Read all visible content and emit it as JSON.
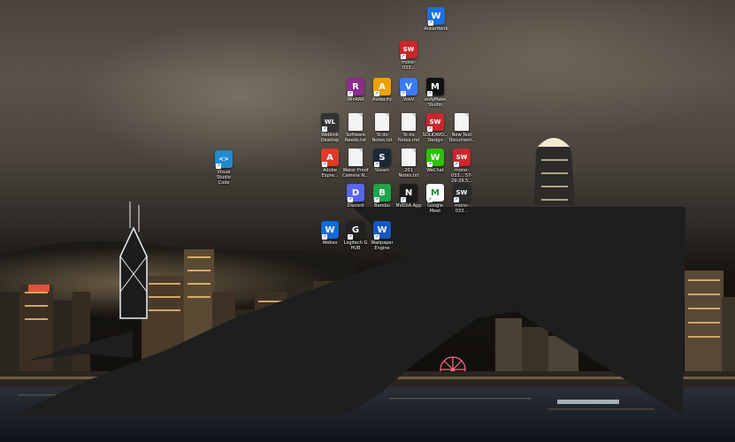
{
  "wallpaper": {
    "sky_color": "#4a443d",
    "water_color": "#1b2430",
    "overlay_color": "#1e1e1e"
  },
  "desktop_icons": [
    {
      "name": "antiwork",
      "label": "AnkerWork",
      "icon": "antiwork-icon",
      "color": "#1e6fe0",
      "glyph": "W"
    },
    {
      "name": "mono-1",
      "label": "mono-033...",
      "icon": "solidworks-icon",
      "color": "#c8282d",
      "glyph": "SW"
    },
    {
      "name": "winrar",
      "label": "WinRAR",
      "icon": "winrar-icon",
      "color": "#8a2d8d",
      "glyph": "R"
    },
    {
      "name": "audacity",
      "label": "Audacity",
      "icon": "audacity-icon",
      "color": "#f0a000",
      "glyph": "A"
    },
    {
      "name": "voov",
      "label": "VooV",
      "icon": "voov-icon",
      "color": "#3a7bff",
      "glyph": "V"
    },
    {
      "name": "eufymake",
      "label": "eufyMake Studio",
      "icon": "eufymake-icon",
      "color": "#111111",
      "glyph": "M"
    },
    {
      "name": "weblink",
      "label": "Weblink Desktop",
      "icon": "weblink-icon",
      "color": "#333333",
      "glyph": "WL"
    },
    {
      "name": "software-needs",
      "label": "Software Needs.txt",
      "icon": "text-file-icon",
      "color": "#f4f4f4",
      "glyph": ""
    },
    {
      "name": "todo-txt",
      "label": "To do Notes.txt",
      "icon": "text-file-icon",
      "color": "#f4f4f4",
      "glyph": ""
    },
    {
      "name": "todo-md",
      "label": "To do Notes.md",
      "icon": "markdown-file-icon",
      "color": "#f4f4f4",
      "glyph": ""
    },
    {
      "name": "solidworks",
      "label": "SOLIDWO... Design",
      "icon": "solidworks-icon",
      "color": "#c8282d",
      "glyph": "SW"
    },
    {
      "name": "new-text",
      "label": "New Text Document...",
      "icon": "text-file-icon",
      "color": "#f4f4f4",
      "glyph": ""
    },
    {
      "name": "vscode",
      "label": "Visual Studio Code",
      "icon": "vscode-icon",
      "color": "#1f8ad2",
      "glyph": "<>"
    },
    {
      "name": "adobe",
      "label": "Adobe Expre...",
      "icon": "adobe-express-icon",
      "color": "#e03a2a",
      "glyph": "A"
    },
    {
      "name": "waterproof",
      "label": "Water Proof Camera N...",
      "icon": "text-file-icon",
      "color": "#f4f4f4",
      "glyph": ""
    },
    {
      "name": "steam",
      "label": "Steam",
      "icon": "steam-icon",
      "color": "#1b2838",
      "glyph": "S"
    },
    {
      "name": "notes201",
      "label": "201 Notes.txt",
      "icon": "text-file-icon",
      "color": "#f4f4f4",
      "glyph": ""
    },
    {
      "name": "wechat",
      "label": "WeChat",
      "icon": "wechat-icon",
      "color": "#2dc100",
      "glyph": "W"
    },
    {
      "name": "mono-2",
      "label": "mono-033... 57-29-29.5...",
      "icon": "solidworks-icon",
      "color": "#c8282d",
      "glyph": "SW"
    },
    {
      "name": "discord",
      "label": "Discord",
      "icon": "discord-icon",
      "color": "#5865f2",
      "glyph": "D"
    },
    {
      "name": "bambu",
      "label": "Bambu",
      "icon": "bambu-icon",
      "color": "#1ea54a",
      "glyph": "B"
    },
    {
      "name": "nvidia",
      "label": "NVIDIA App",
      "icon": "nvidia-icon",
      "color": "#1a1a1a",
      "glyph": "N"
    },
    {
      "name": "googlemeet",
      "label": "Google Meet",
      "icon": "google-meet-icon",
      "color": "#ffffff",
      "glyph": "M"
    },
    {
      "name": "mono-3",
      "label": "mono-033...",
      "icon": "solidworks-icon",
      "color": "#2a2a2a",
      "glyph": "SW"
    },
    {
      "name": "webex",
      "label": "Webex",
      "icon": "webex-icon",
      "color": "#0b6bd6",
      "glyph": "W"
    },
    {
      "name": "logitech",
      "label": "Logitech G HUB",
      "icon": "logitech-icon",
      "color": "#222222",
      "glyph": "G"
    },
    {
      "name": "wallpaper",
      "label": "Wallpaper Engine",
      "icon": "wallpaper-engine-icon",
      "color": "#1558c0",
      "glyph": "W"
    }
  ]
}
